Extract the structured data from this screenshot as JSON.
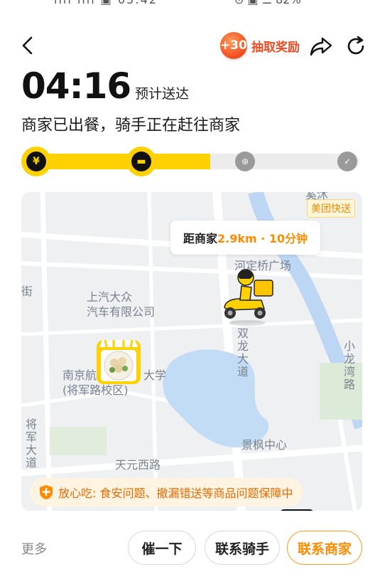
{
  "status_bar": {
    "left": "ııll ııll ▣ 05:42",
    "right": "⊙ ▣ ☰ 82%"
  },
  "header": {
    "reward_badge": "+30",
    "reward_label": "抽取奖励"
  },
  "eta": {
    "time": "04:16",
    "label": "预计送达"
  },
  "status_text": "商家已出餐，骑手正在赶往商家",
  "progress": {
    "fraction": 0.55,
    "steps": [
      {
        "icon": "yen-icon",
        "state": "done",
        "glyph": "¥"
      },
      {
        "icon": "shop-icon",
        "state": "done",
        "glyph": "▬"
      },
      {
        "icon": "scooter-icon",
        "state": "todo",
        "glyph": "⊛"
      },
      {
        "icon": "check-icon",
        "state": "todo",
        "glyph": "✓"
      }
    ]
  },
  "map": {
    "brand_tag": "美团快送",
    "distance_prefix": "距商家",
    "distance_value": "2.9km · 10分钟",
    "labels": {
      "tl": "奚沭",
      "jie": "街",
      "hedingqiao": "河定桥广场",
      "shangqi_1": "上汽大众",
      "shangqi_2": "汽车有限公司",
      "nanjing_1": "南京航",
      "nanjing_2": "大学",
      "nanjing_3": "(将军路校区)",
      "shuanglong": "双龙大道",
      "xiaolong": "小龙湾路",
      "jiangjun": "将军大道",
      "jingfeng": "景枫中心",
      "tianyuan": "天元西路"
    },
    "guarantee": "放心吃: 食安问题、撤漏错送等商品问题保障中"
  },
  "footer": {
    "more": "更多",
    "urge": "催一下",
    "contact_rider": "联系骑手",
    "contact_shop": "联系商家"
  },
  "colors": {
    "accent": "#ffd100",
    "orange": "#ff8a00",
    "reward": "#ef4b23"
  }
}
